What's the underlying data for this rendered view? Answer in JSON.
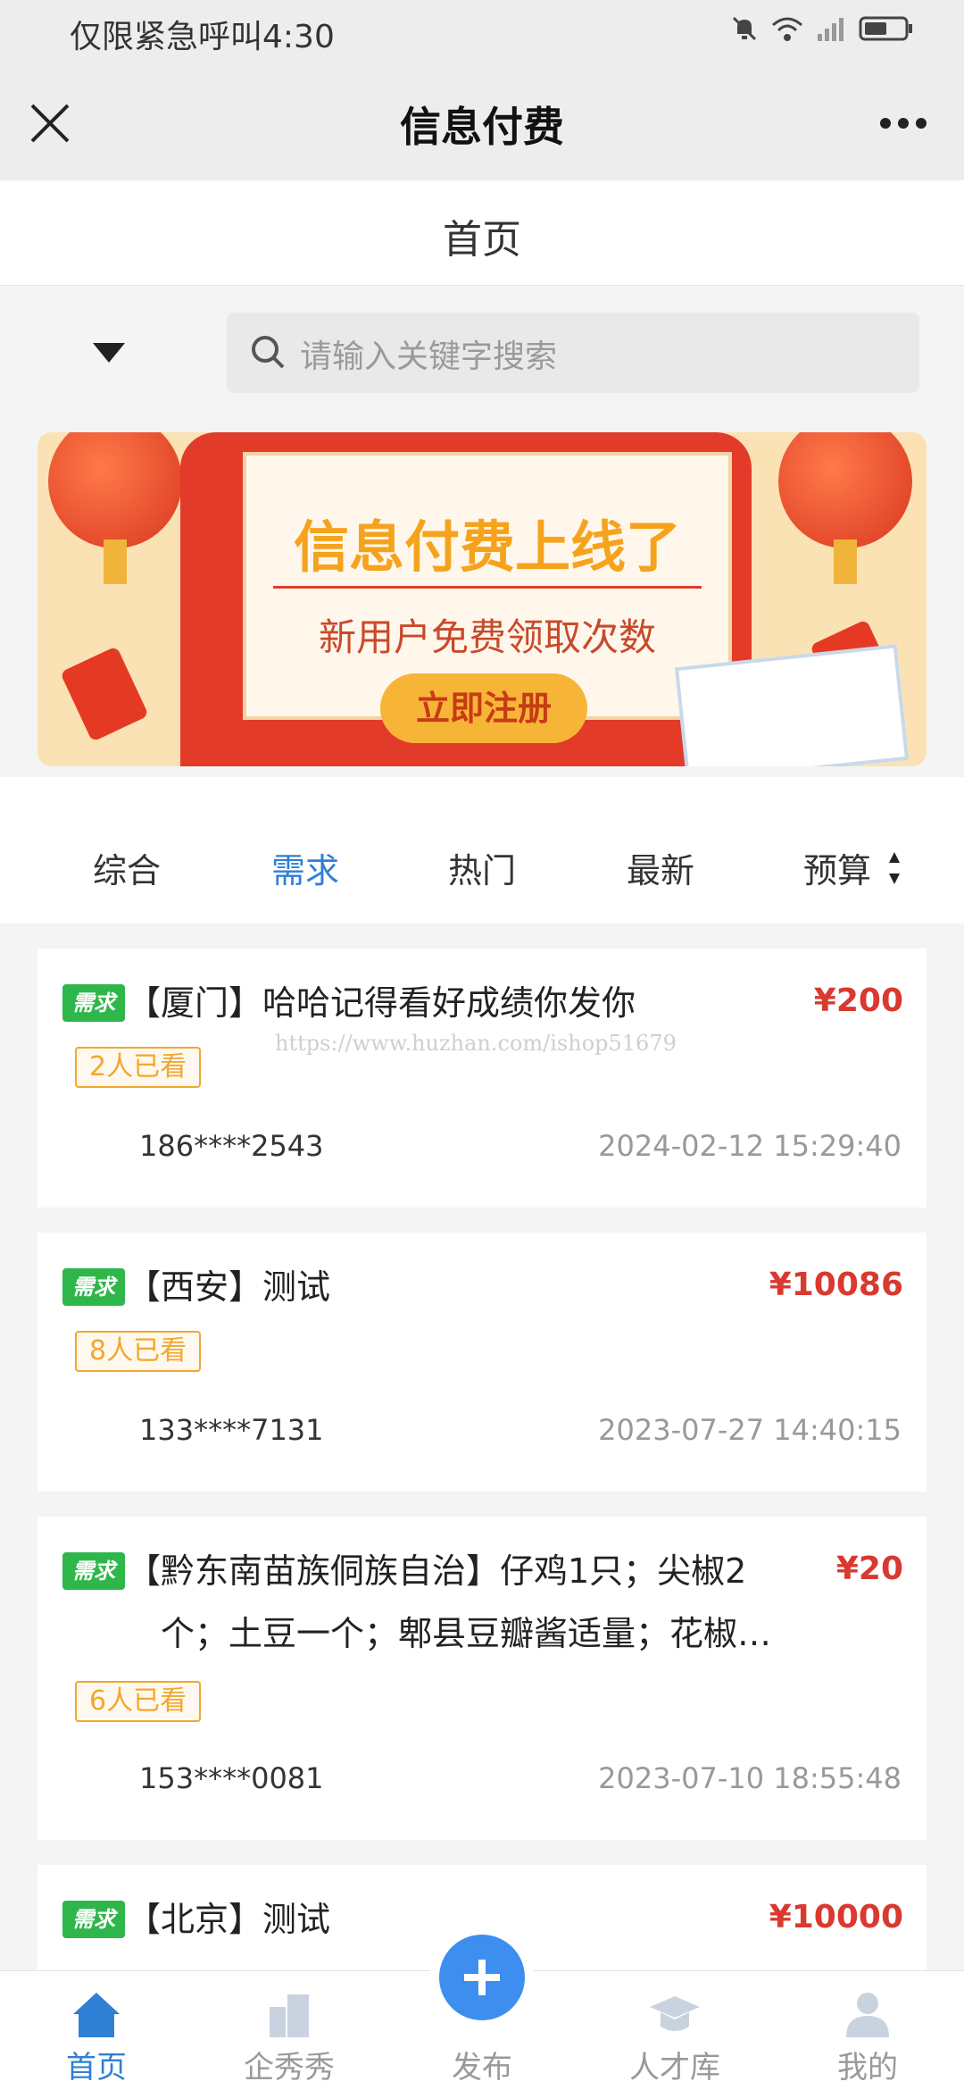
{
  "status_bar": {
    "carrier": "仅限紧急呼叫",
    "time": "4:30"
  },
  "navbar": {
    "title": "信息付费"
  },
  "page_header": {
    "title": "首页"
  },
  "search": {
    "placeholder": "请输入关键字搜索"
  },
  "banner": {
    "title": "信息付费上线了",
    "subtitle": "新用户免费领取次数",
    "button": "立即注册"
  },
  "filter_tabs": {
    "items": [
      {
        "label": "综合"
      },
      {
        "label": "需求"
      },
      {
        "label": "热门"
      },
      {
        "label": "最新"
      },
      {
        "label": "预算"
      }
    ],
    "active": "需求"
  },
  "watermark": "https://www.huzhan.com/ishop51679",
  "listings": [
    {
      "tag": "需求",
      "title": "【厦门】哈哈记得看好成绩你发你",
      "price": "¥200",
      "seen": "2人已看",
      "phone": "186****2543",
      "date": "2024-02-12 15:29:40"
    },
    {
      "tag": "需求",
      "title": "【西安】测试",
      "price": "¥10086",
      "seen": "8人已看",
      "phone": "133****7131",
      "date": "2023-07-27 14:40:15"
    },
    {
      "tag": "需求",
      "title_line1": "【黔东南苗族侗族自治】仔鸡1只；尖椒2",
      "title_line2": "个；土豆一个；郫县豆瓣酱适量；花椒…",
      "price": "¥20",
      "seen": "6人已看",
      "phone": "153****0081",
      "date": "2023-07-10 18:55:48"
    },
    {
      "tag": "需求",
      "title": "【北京】测试",
      "price": "¥10000"
    }
  ],
  "bottom_nav": {
    "items": [
      {
        "label": "首页"
      },
      {
        "label": "企秀秀"
      },
      {
        "label": "发布"
      },
      {
        "label": "人才库"
      },
      {
        "label": "我的"
      }
    ]
  },
  "colors": {
    "accent": "#2f7fd4",
    "price": "#d9392f",
    "tag": "#2fb64a",
    "seen": "#f0a830",
    "fab": "#3e8ef0"
  }
}
